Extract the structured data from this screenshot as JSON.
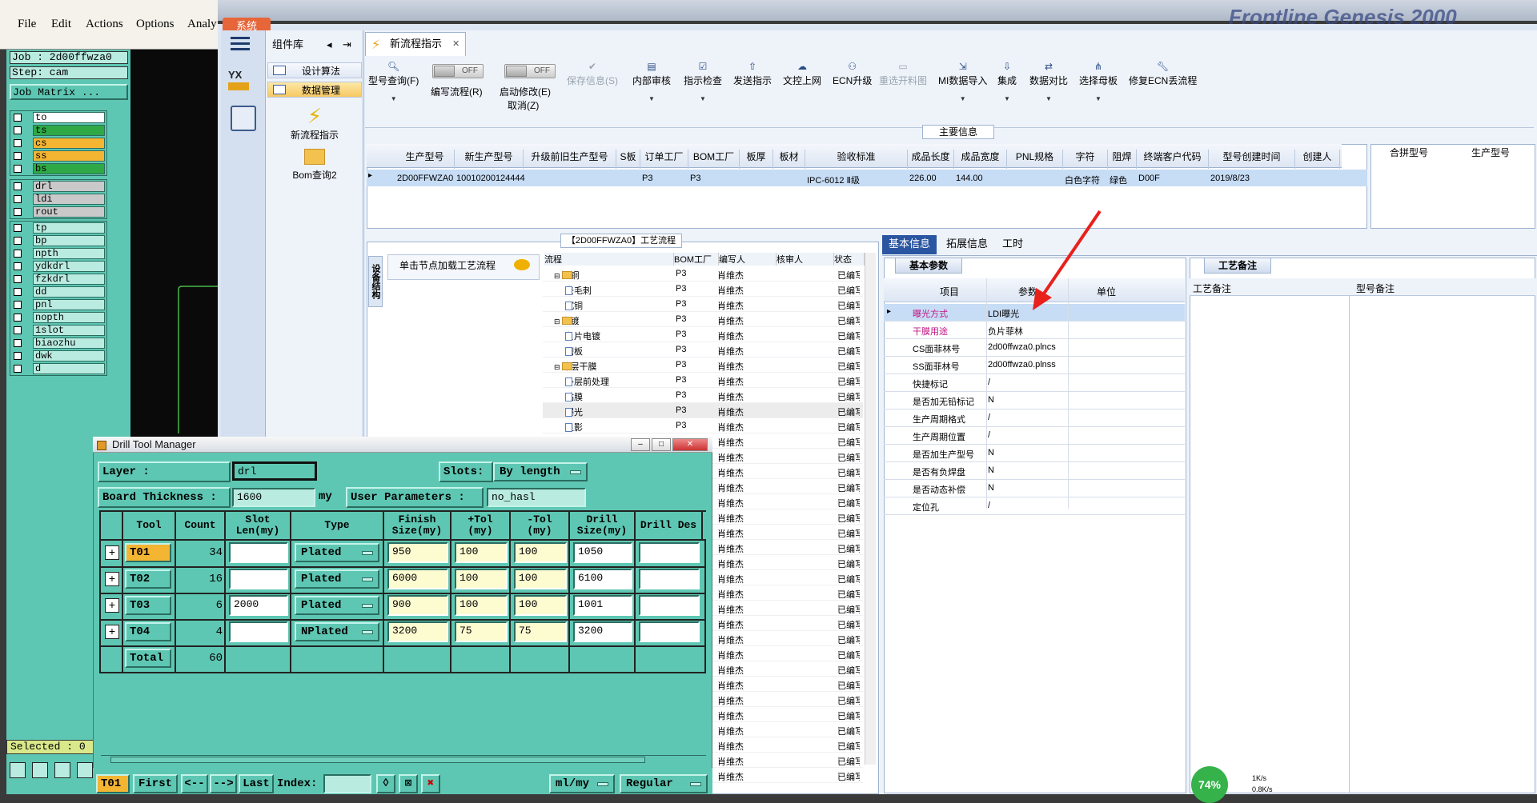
{
  "genesis": {
    "menu": [
      "File",
      "Edit",
      "Actions",
      "Options",
      "Analy"
    ],
    "job": "Job : 2d00ffwza0",
    "step": "Step: cam",
    "job_matrix": "Job Matrix ...",
    "layers_group1": [
      {
        "name": "to",
        "color": "#ffffff"
      },
      {
        "name": "ts",
        "color": "#2fa845"
      },
      {
        "name": "cs",
        "color": "#f4b533"
      },
      {
        "name": "ss",
        "color": "#f4b533"
      },
      {
        "name": "bs",
        "color": "#2fa845"
      }
    ],
    "layers_group2": [
      "drl",
      "ldi",
      "rout"
    ],
    "layers_group3": [
      "tp",
      "bp",
      "npth",
      "ydkdrl",
      "fzkdrl",
      "dd",
      "pnl",
      "nopth",
      "1slot",
      "biaozhu",
      "dwk",
      "d"
    ],
    "selected": "Selected : 0"
  },
  "app": {
    "system_tab": "系统",
    "brand": "Frontline Genesis 2000",
    "component_library": "组件库",
    "design_algorithm": "设计算法",
    "data_management": "数据管理",
    "new_flow_label": "新流程指示",
    "bom_query_label": "Bom查询2",
    "yx_label": "YX",
    "active_tab": "新流程指示"
  },
  "toolbar": {
    "model_query": "型号查询(F)",
    "edit_flow": "编写流程(R)",
    "start_modify": "启动修改(E)",
    "cancel": "取消(Z)",
    "toggle_off": "OFF",
    "save_info": "保存信息(S)",
    "internal_review": "内部审核",
    "instruction_check": "指示检查",
    "send_instruction": "发送指示",
    "doc_upload": "文控上网",
    "ecn_upgrade": "ECN升级",
    "remake_drawing": "重选开料图",
    "mi_import": "MI数据导入",
    "integrate": "集成",
    "data_compare": "数据对比",
    "select_mother": "选择母板",
    "fix_ecn": "修复ECN丢流程"
  },
  "main_info": {
    "title": "主要信息",
    "headers": [
      "生产型号",
      "新生产型号",
      "升级前旧生产型号",
      "S板",
      "订单工厂",
      "BOM工厂",
      "板厚",
      "板材",
      "验收标准",
      "成品长度",
      "成品宽度",
      "PNL规格",
      "字符",
      "阻焊",
      "终端客户代码",
      "型号创建时间",
      "创建人"
    ],
    "row": [
      "2D00FFWZA0",
      "10010200124444",
      "",
      "",
      "P3",
      "P3",
      "",
      "",
      "IPC-6012 Ⅱ级",
      "226.00",
      "144.00",
      "",
      "白色字符",
      "绿色",
      "D00F",
      "2019/8/23",
      ""
    ],
    "merge_headers": [
      "合拼型号",
      "生产型号"
    ]
  },
  "flow": {
    "title": "【2D00FFWZA0】工艺流程",
    "side_tab": "设备结构",
    "hint": "单击节点加载工艺流程",
    "headers": [
      "流程",
      "BOM工厂",
      "编写人",
      "核审人",
      "状态"
    ],
    "rows": [
      {
        "name": "沉铜",
        "type": "folder",
        "indent": 0,
        "factory": "P3",
        "writer": "肖维杰",
        "status": "已编写"
      },
      {
        "name": "去毛刺",
        "type": "doc",
        "indent": 1,
        "factory": "P3",
        "writer": "肖维杰",
        "status": "已编写"
      },
      {
        "name": "沉铜",
        "type": "doc",
        "indent": 1,
        "factory": "P3",
        "writer": "肖维杰",
        "status": "已编写"
      },
      {
        "name": "电镀",
        "type": "folder",
        "indent": 0,
        "factory": "P3",
        "writer": "肖维杰",
        "status": "已编写"
      },
      {
        "name": "负片电镀",
        "type": "doc",
        "indent": 1,
        "factory": "P3",
        "writer": "肖维杰",
        "status": "已编写"
      },
      {
        "name": "磨板",
        "type": "doc",
        "indent": 1,
        "factory": "P3",
        "writer": "肖维杰",
        "status": "已编写"
      },
      {
        "name": "外层干膜",
        "type": "folder",
        "indent": 0,
        "factory": "P3",
        "writer": "肖维杰",
        "status": "已编写"
      },
      {
        "name": "外层前处理",
        "type": "doc",
        "indent": 1,
        "factory": "P3",
        "writer": "肖维杰",
        "status": "已编写"
      },
      {
        "name": "贴膜",
        "type": "doc",
        "indent": 1,
        "factory": "P3",
        "writer": "肖维杰",
        "status": "已编写"
      },
      {
        "name": "曝光",
        "type": "doc",
        "indent": 1,
        "factory": "P3",
        "writer": "肖维杰",
        "status": "已编写",
        "selected": true
      },
      {
        "name": "显影",
        "type": "doc",
        "indent": 1,
        "factory": "P3",
        "writer": "肖维杰",
        "status": "已编写"
      },
      {
        "name": "",
        "type": "none",
        "indent": 1,
        "factory": "",
        "writer": "肖维杰",
        "status": "已编写"
      },
      {
        "name": "",
        "type": "none",
        "indent": 1,
        "factory": "",
        "writer": "肖维杰",
        "status": "已编写"
      },
      {
        "name": "",
        "type": "none",
        "indent": 1,
        "factory": "",
        "writer": "肖维杰",
        "status": "已编写"
      },
      {
        "name": "",
        "type": "none",
        "indent": 1,
        "factory": "",
        "writer": "肖维杰",
        "status": "已编写"
      },
      {
        "name": "",
        "type": "none",
        "indent": 1,
        "factory": "",
        "writer": "肖维杰",
        "status": "已编写"
      },
      {
        "name": "",
        "type": "none",
        "indent": 1,
        "factory": "",
        "writer": "肖维杰",
        "status": "已编写"
      },
      {
        "name": "",
        "type": "none",
        "indent": 1,
        "factory": "",
        "writer": "肖维杰",
        "status": "已编写"
      },
      {
        "name": "",
        "type": "none",
        "indent": 1,
        "factory": "",
        "writer": "肖维杰",
        "status": "已编写"
      },
      {
        "name": "",
        "type": "none",
        "indent": 1,
        "factory": "",
        "writer": "肖维杰",
        "status": "已编写"
      },
      {
        "name": "",
        "type": "none",
        "indent": 1,
        "factory": "",
        "writer": "肖维杰",
        "status": "已编写"
      },
      {
        "name": "",
        "type": "none",
        "indent": 1,
        "factory": "",
        "writer": "肖维杰",
        "status": "已编写"
      },
      {
        "name": "",
        "type": "none",
        "indent": 1,
        "factory": "",
        "writer": "肖维杰",
        "status": "已编写"
      },
      {
        "name": "",
        "type": "none",
        "indent": 1,
        "factory": "",
        "writer": "肖维杰",
        "status": "已编写"
      },
      {
        "name": "",
        "type": "none",
        "indent": 1,
        "factory": "",
        "writer": "肖维杰",
        "status": "已编写"
      },
      {
        "name": "",
        "type": "none",
        "indent": 1,
        "factory": "",
        "writer": "肖维杰",
        "status": "已编写"
      },
      {
        "name": "",
        "type": "none",
        "indent": 1,
        "factory": "",
        "writer": "肖维杰",
        "status": "已编写"
      },
      {
        "name": "",
        "type": "none",
        "indent": 1,
        "factory": "",
        "writer": "肖维杰",
        "status": "已编写"
      },
      {
        "name": "",
        "type": "none",
        "indent": 1,
        "factory": "",
        "writer": "肖维杰",
        "status": "已编写"
      },
      {
        "name": "",
        "type": "none",
        "indent": 1,
        "factory": "",
        "writer": "肖维杰",
        "status": "已编写"
      },
      {
        "name": "",
        "type": "none",
        "indent": 1,
        "factory": "",
        "writer": "肖维杰",
        "status": "已编写"
      },
      {
        "name": "",
        "type": "none",
        "indent": 1,
        "factory": "",
        "writer": "肖维杰",
        "status": "已编写"
      },
      {
        "name": "",
        "type": "none",
        "indent": 1,
        "factory": "",
        "writer": "肖维杰",
        "status": "已编写"
      },
      {
        "name": "",
        "type": "none",
        "indent": 1,
        "factory": "",
        "writer": "肖维杰",
        "status": "已编写"
      }
    ]
  },
  "right": {
    "tabs": [
      "基本信息",
      "拓展信息",
      "工时"
    ],
    "basic_title": "基本参数",
    "prop_headers": [
      "项目",
      "参数",
      "单位"
    ],
    "props": [
      {
        "k": "曝光方式",
        "v": "LDI曝光",
        "pink": true
      },
      {
        "k": "干膜用途",
        "v": "负片菲林",
        "pink": true
      },
      {
        "k": "CS面菲林号",
        "v": "2d00ffwza0.plncs",
        "pink": false
      },
      {
        "k": "SS面菲林号",
        "v": "2d00ffwza0.plnss",
        "pink": false
      },
      {
        "k": "快捷标记",
        "v": "/",
        "pink": false
      },
      {
        "k": "是否加无铅标记",
        "v": "N",
        "pink": false
      },
      {
        "k": "生产周期格式",
        "v": "/",
        "pink": false
      },
      {
        "k": "生产周期位置",
        "v": "/",
        "pink": false
      },
      {
        "k": "是否加生产型号",
        "v": "N",
        "pink": false
      },
      {
        "k": "是否有负焊盘",
        "v": "N",
        "pink": false
      },
      {
        "k": "是否动态补偿",
        "v": "N",
        "pink": false
      },
      {
        "k": "定位孔",
        "v": "/",
        "pink": false
      }
    ],
    "craft_title": "工艺备注",
    "craft_headers": [
      "工艺备注",
      "型号备注"
    ]
  },
  "network": {
    "percent": "74%",
    "up": "1K/s",
    "down": "0.8K/s"
  },
  "drill": {
    "title": "Drill Tool Manager",
    "layer_label": "Layer          :",
    "layer_value": "drl",
    "slots_label": "Slots:",
    "slots_value": "By length",
    "thickness_label": "Board Thickness :",
    "thickness_value": "1600",
    "thickness_unit": "my",
    "user_params_label": "User Parameters :",
    "user_params_value": "no_hasl",
    "headers": [
      "Tool",
      "Count",
      "Slot Len(my)",
      "Type",
      "Finish Size(my)",
      "+Tol (my)",
      "-Tol (my)",
      "Drill Size(my)",
      "Drill Des"
    ],
    "rows": [
      {
        "tool": "T01",
        "count": "34",
        "slot": "",
        "type": "Plated",
        "finish": "950",
        "ptol": "100",
        "ntol": "100",
        "drill": "1050",
        "des": ""
      },
      {
        "tool": "T02",
        "count": "16",
        "slot": "",
        "type": "Plated",
        "finish": "6000",
        "ptol": "100",
        "ntol": "100",
        "drill": "6100",
        "des": ""
      },
      {
        "tool": "T03",
        "count": "6",
        "slot": "2000",
        "type": "Plated",
        "finish": "900",
        "ptol": "100",
        "ntol": "100",
        "drill": "1001",
        "des": ""
      },
      {
        "tool": "T04",
        "count": "4",
        "slot": "",
        "type": "NPlated",
        "finish": "3200",
        "ptol": "75",
        "ntol": "75",
        "drill": "3200",
        "des": ""
      }
    ],
    "total_label": "Total",
    "total_count": "60",
    "bottom": {
      "current": "T01",
      "first": "First",
      "prev": "<--",
      "next": "-->",
      "last": "Last",
      "index_label": "Index:",
      "unit": "ml/my",
      "mode": "Regular"
    }
  }
}
